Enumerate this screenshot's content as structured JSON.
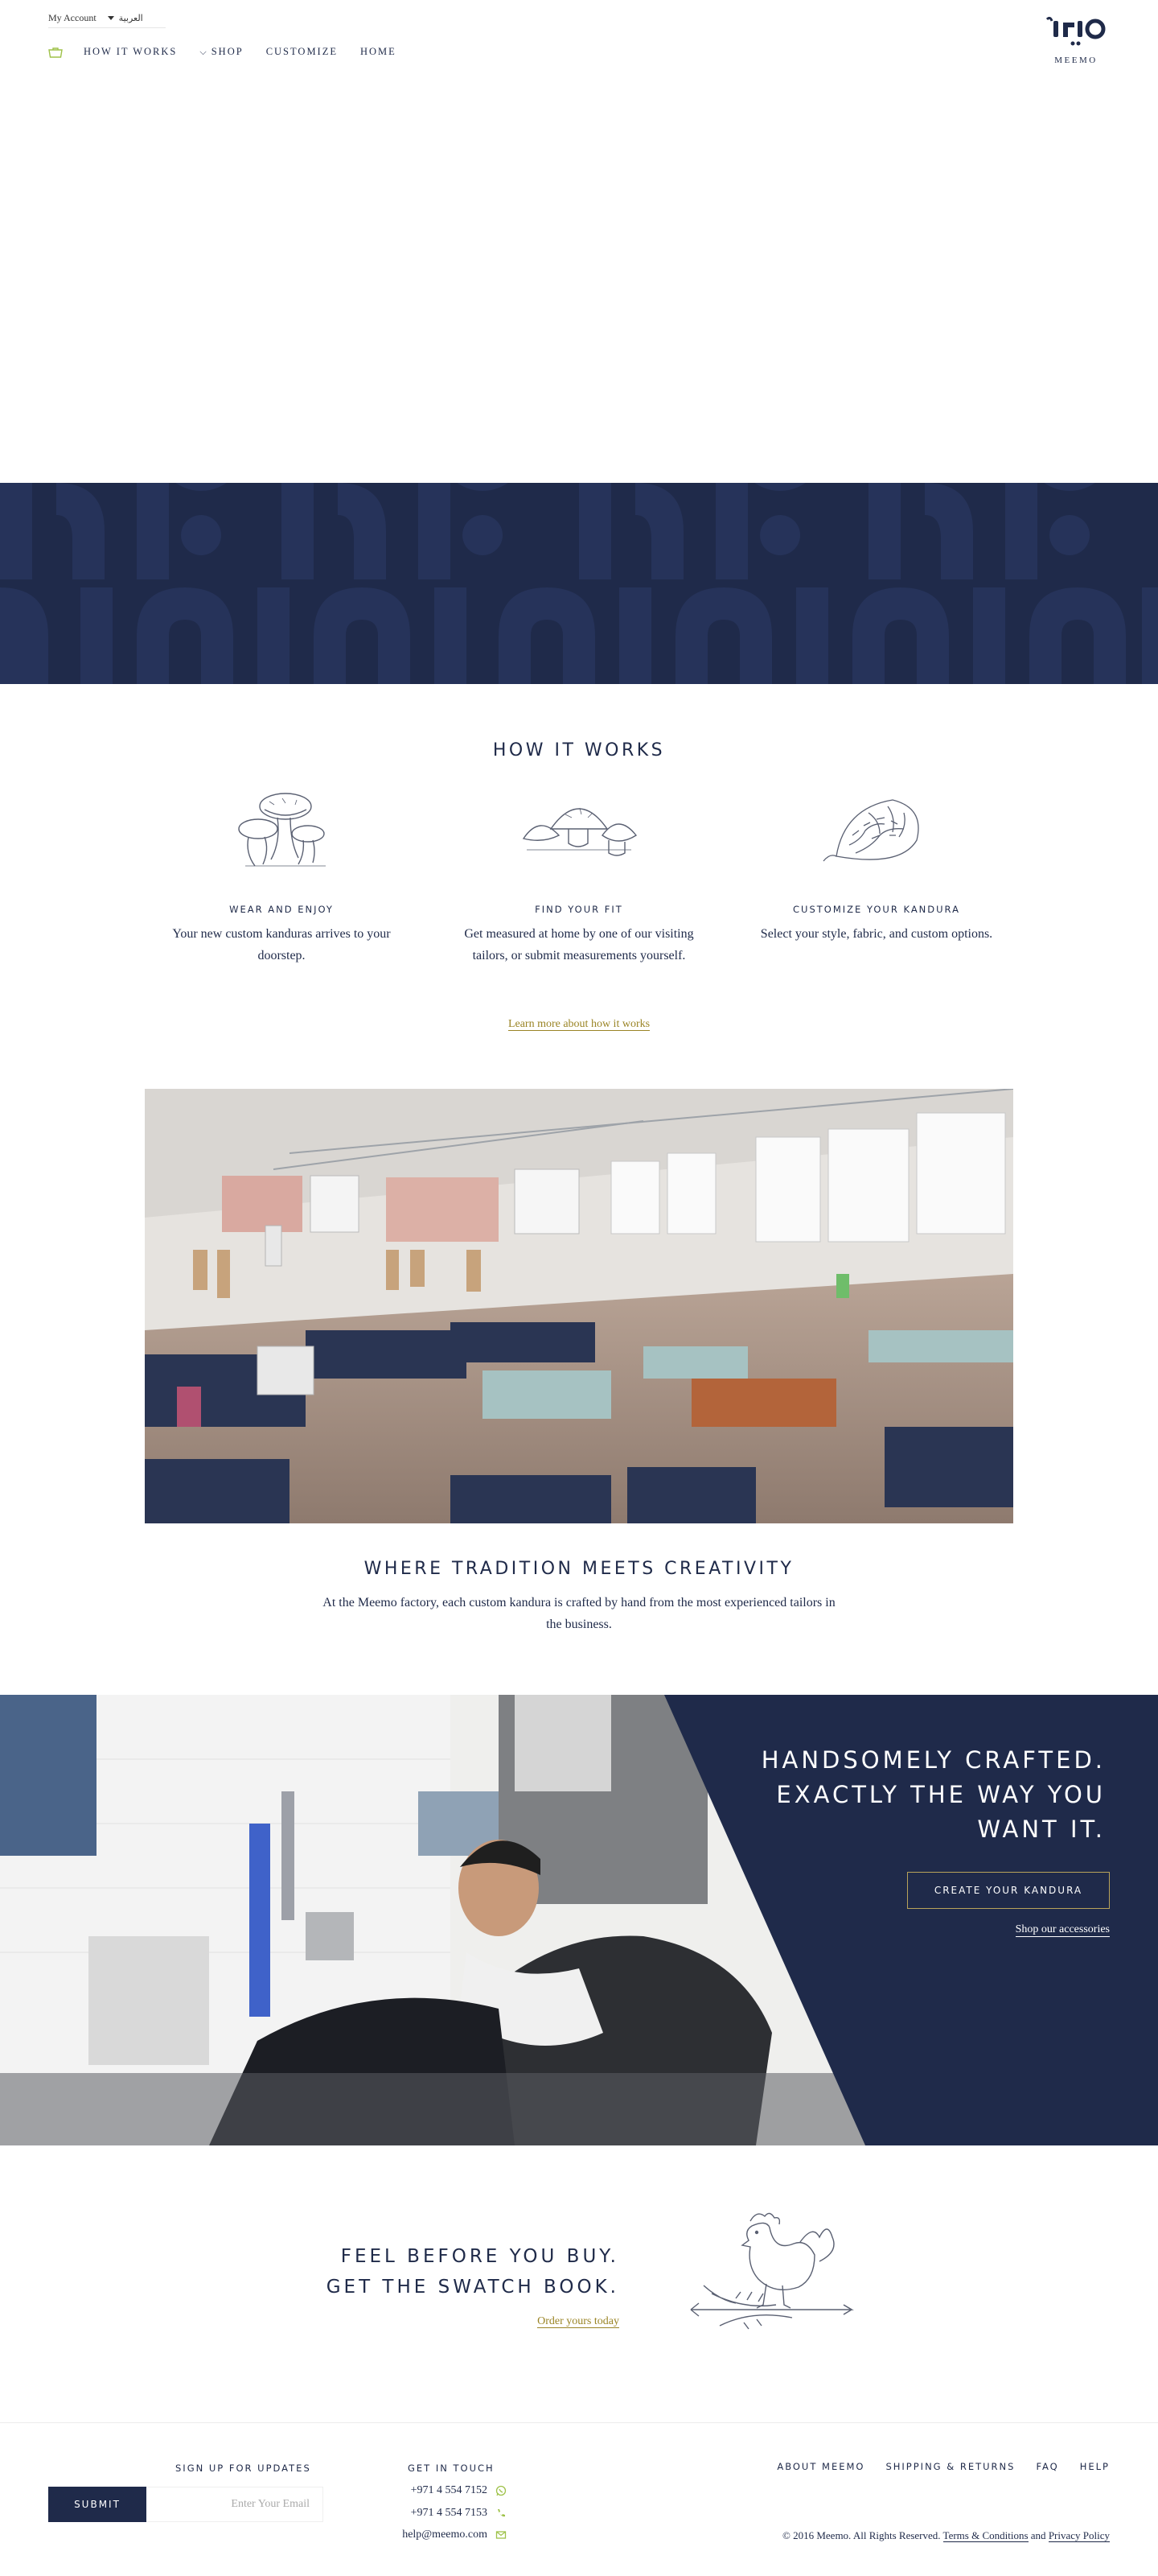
{
  "header": {
    "account_label": "My Account",
    "language_label": "العربية",
    "nav": {
      "how_it_works": "HOW IT WORKS",
      "shop": "SHOP",
      "customize": "CUSTOMIZE",
      "home": "HOME"
    },
    "logo_text": "MEEMO"
  },
  "how_it_works": {
    "title": "HOW IT WORKS",
    "steps": [
      {
        "title": "WEAR AND ENJOY",
        "description": "Your new custom kanduras arrives to your doorstep.",
        "icon": "mushrooms-sketch-icon"
      },
      {
        "title": "FIND YOUR FIT",
        "description": "Get measured at home by one of our visiting tailors, or submit measurements yourself.",
        "icon": "mushroom-sketch-icon"
      },
      {
        "title": "CUSTOMIZE YOUR KANDURA",
        "description": "Select your style, fabric, and custom options.",
        "icon": "pinecone-sketch-icon"
      }
    ],
    "link": "Learn more about how it works"
  },
  "tradition": {
    "title": "WHERE TRADITION MEETS CREATIVITY",
    "description": "At the Meemo factory, each custom kandura is crafted by hand from the most experienced tailors in the business."
  },
  "crafted": {
    "headline_line1": "HANDSOMELY CRAFTED.",
    "headline_line2": "EXACTLY THE WAY YOU",
    "headline_line3": "WANT IT.",
    "cta": "CREATE YOUR KANDURA",
    "link": "Shop our accessories"
  },
  "swatch": {
    "line1": "FEEL BEFORE YOU BUY.",
    "line2": "GET THE SWATCH BOOK.",
    "link": "Order yours today"
  },
  "footer": {
    "signup_title": "SIGN UP FOR UPDATES",
    "submit": "SUBMIT",
    "email_placeholder": "Enter Your Email",
    "contact_title": "GET IN TOUCH",
    "phone1": "+971 4 554 7152",
    "phone2": "+971 4 554 7153",
    "email": "help@meemo.com",
    "nav": {
      "about": "ABOUT MEEMO",
      "shipping": "SHIPPING & RETURNS",
      "faq": "FAQ",
      "help": "HELP"
    },
    "copyright": "© 2016 Meemo. All Rights Reserved.",
    "terms": "Terms & Conditions",
    "and": "and",
    "privacy": "Privacy Policy"
  },
  "colors": {
    "navy": "#1f2a4a",
    "gold": "#9a8425",
    "accent_green": "#9fc24a"
  }
}
